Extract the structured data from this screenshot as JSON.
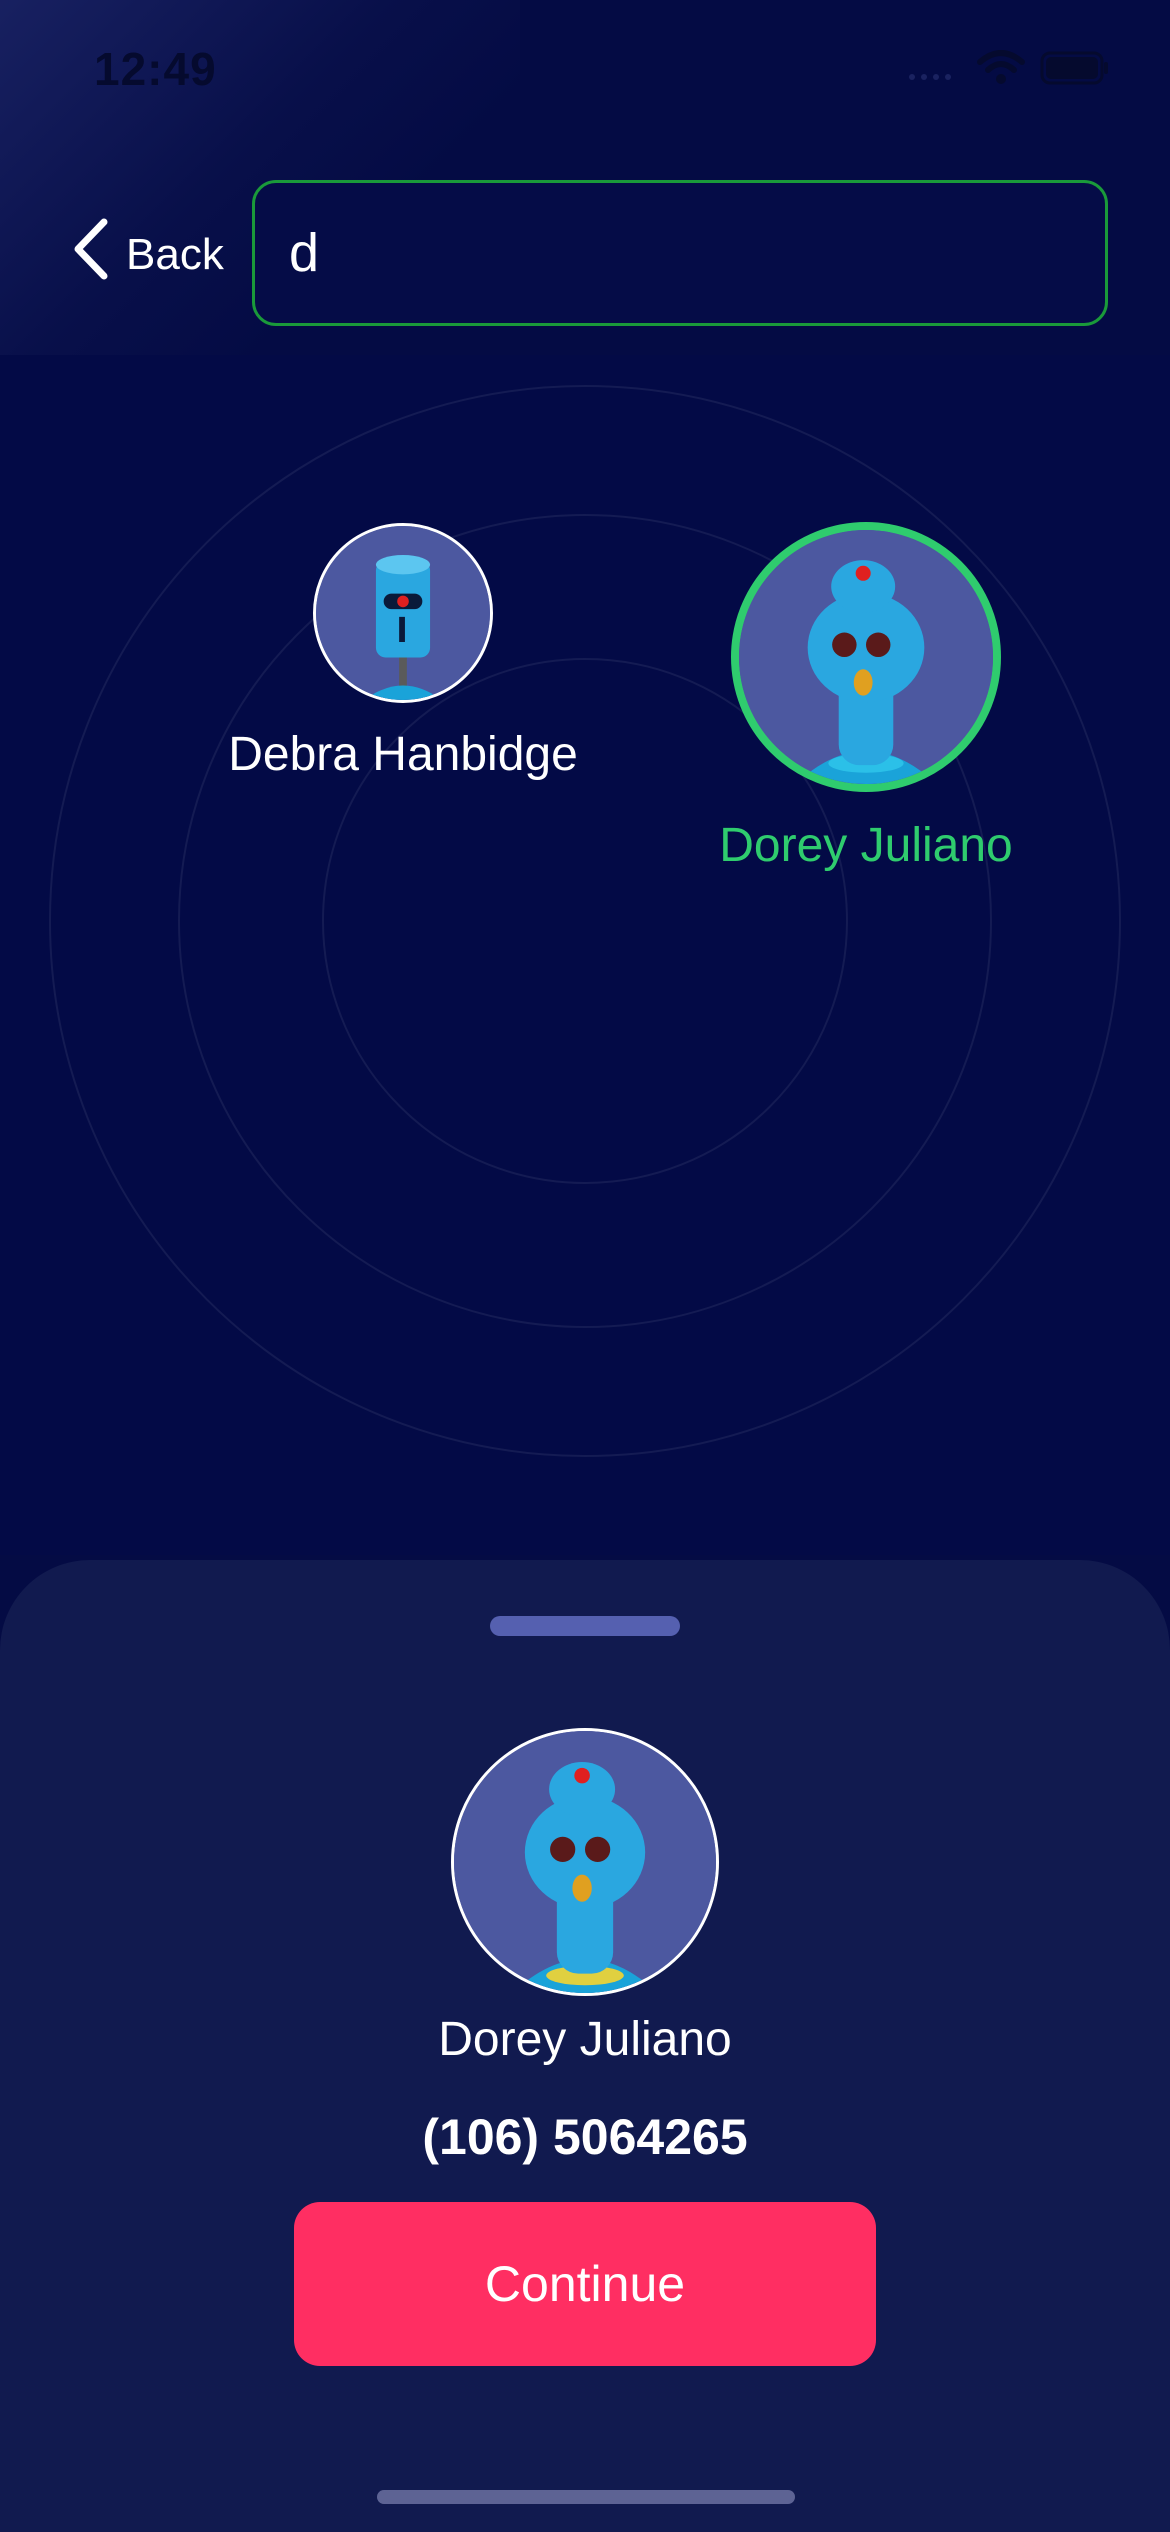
{
  "status_bar": {
    "time": "12:49",
    "icons": [
      "cellular-icon",
      "wifi-icon",
      "battery-icon"
    ]
  },
  "header": {
    "back_label": "Back",
    "search_value": "d"
  },
  "results": [
    {
      "name": "Debra Hanbidge",
      "selected": false,
      "name_color": "#ffffff"
    },
    {
      "name": "Dorey Juliano",
      "selected": true,
      "name_color": "#2fcc6e"
    }
  ],
  "sheet": {
    "name": "Dorey Juliano",
    "phone": "(106) 5064265",
    "continue_label": "Continue"
  },
  "colors": {
    "background": "#040b44",
    "sheet": "#111a4f",
    "accent_green": "#2fcc6e",
    "search_border": "#1a9a3a",
    "continue": "#ff2e62"
  }
}
